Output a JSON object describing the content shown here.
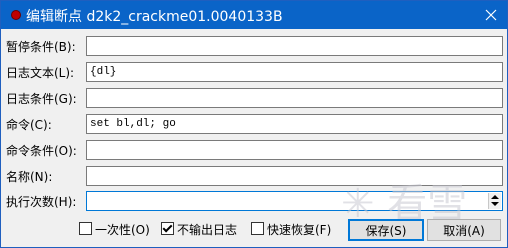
{
  "window": {
    "title": "编辑断点 d2k2_crackme01.0040133B"
  },
  "fields": [
    {
      "label": "暂停条件(B):",
      "value": ""
    },
    {
      "label": "日志文本(L):",
      "value": "{dl}"
    },
    {
      "label": "日志条件(G):",
      "value": ""
    },
    {
      "label": "命令(C):",
      "value": "set bl,dl; go"
    },
    {
      "label": "命令条件(O):",
      "value": ""
    },
    {
      "label": "名称(N):",
      "value": ""
    },
    {
      "label": "执行次数(H):",
      "value": ""
    }
  ],
  "options": [
    {
      "label": "一次性(O)",
      "checked": false
    },
    {
      "label": "不输出日志",
      "checked": true
    },
    {
      "label": "快速恢复(F)",
      "checked": false
    }
  ],
  "buttons": {
    "save": "保存(S)",
    "cancel": "取消(A)"
  },
  "watermark": "看雪"
}
